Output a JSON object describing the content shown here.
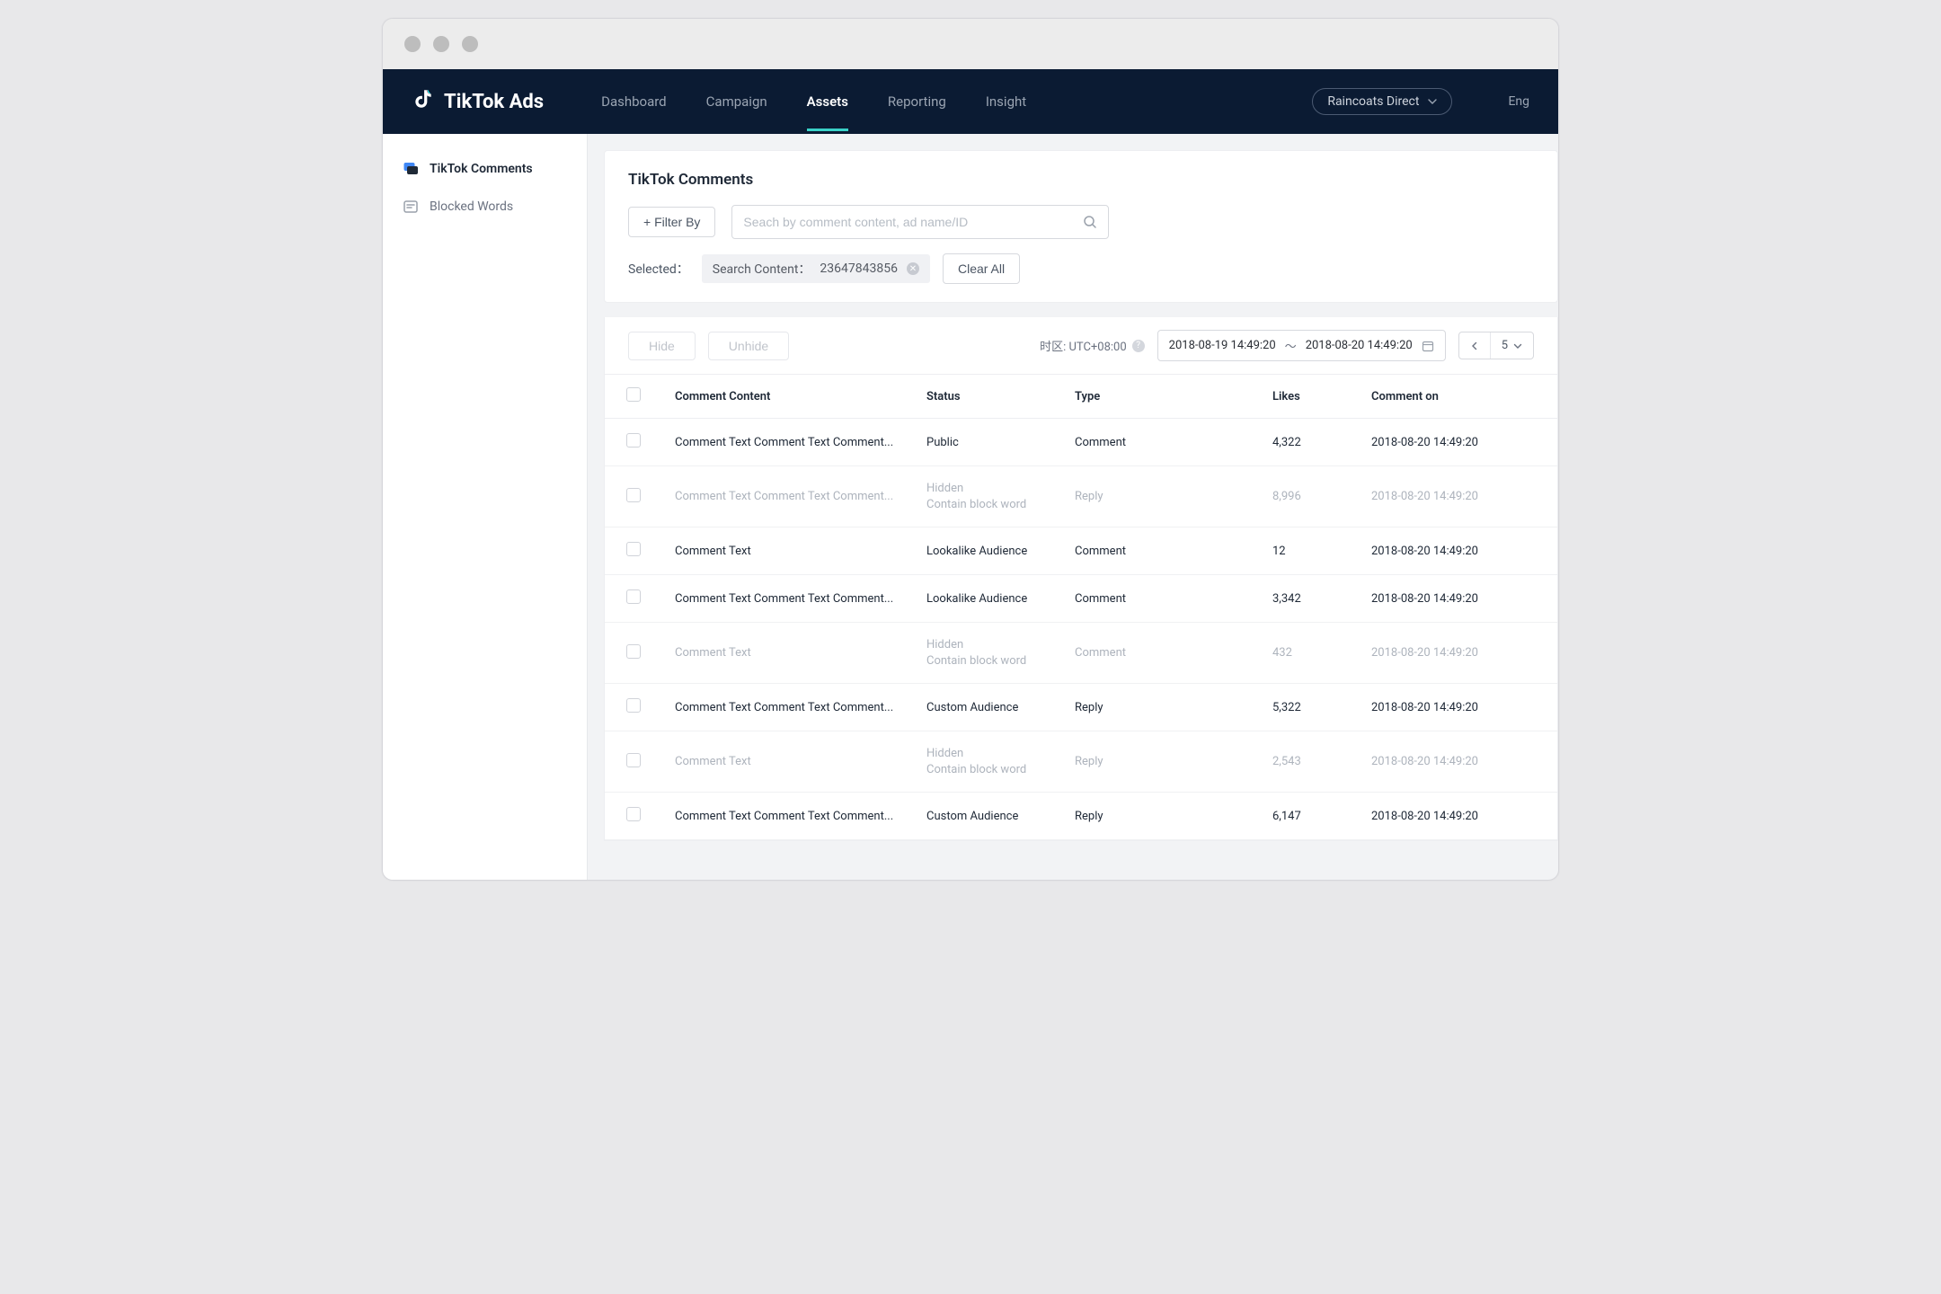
{
  "brand": {
    "name": "TikTok Ads"
  },
  "nav": {
    "items": [
      {
        "label": "Dashboard",
        "active": false
      },
      {
        "label": "Campaign",
        "active": false
      },
      {
        "label": "Assets",
        "active": true
      },
      {
        "label": "Reporting",
        "active": false
      },
      {
        "label": "Insight",
        "active": false
      }
    ],
    "account": "Raincoats Direct",
    "lang": "Eng"
  },
  "sidebar": {
    "items": [
      {
        "label": "TikTok Comments",
        "icon": "comments-icon",
        "active": true
      },
      {
        "label": "Blocked Words",
        "icon": "blocked-icon",
        "active": false
      }
    ]
  },
  "panel": {
    "title": "TikTok Comments",
    "filter_button": "+ Filter By",
    "search_placeholder": "Seach by comment content, ad name/ID",
    "selected_label": "Selected：",
    "selected_chip_prefix": "Search Content：",
    "selected_chip_value": "23647843856",
    "clear_all": "Clear All"
  },
  "toolbar": {
    "hide": "Hide",
    "unhide": "Unhide",
    "tz_label": "时区: UTC+08:00",
    "date_from": "2018-08-19 14:49:20",
    "date_sep": "～",
    "date_to": "2018-08-20 14:49:20",
    "page_size": "5"
  },
  "table": {
    "headers": {
      "content": "Comment Content",
      "status": "Status",
      "type": "Type",
      "likes": "Likes",
      "date": "Comment on"
    },
    "rows": [
      {
        "content": "Comment Text Comment Text Comment...",
        "status1": "Public",
        "status2": "",
        "type": "Comment",
        "likes": "4,322",
        "date": "2018-08-20 14:49:20",
        "dim": false
      },
      {
        "content": "Comment Text Comment Text Comment...",
        "status1": "Hidden",
        "status2": "Contain block word",
        "type": "Reply",
        "likes": "8,996",
        "date": "2018-08-20 14:49:20",
        "dim": true
      },
      {
        "content": "Comment Text",
        "status1": "Lookalike Audience",
        "status2": "",
        "type": "Comment",
        "likes": "12",
        "date": "2018-08-20 14:49:20",
        "dim": false
      },
      {
        "content": "Comment Text Comment Text Comment...",
        "status1": "Lookalike Audience",
        "status2": "",
        "type": "Comment",
        "likes": "3,342",
        "date": "2018-08-20 14:49:20",
        "dim": false
      },
      {
        "content": "Comment Text",
        "status1": "Hidden",
        "status2": "Contain block word",
        "type": "Comment",
        "likes": "432",
        "date": "2018-08-20 14:49:20",
        "dim": true
      },
      {
        "content": "Comment Text Comment Text Comment...",
        "status1": "Custom Audience",
        "status2": "",
        "type": "Reply",
        "likes": "5,322",
        "date": "2018-08-20 14:49:20",
        "dim": false
      },
      {
        "content": "Comment Text",
        "status1": "Hidden",
        "status2": "Contain block word",
        "type": "Reply",
        "likes": "2,543",
        "date": "2018-08-20 14:49:20",
        "dim": true
      },
      {
        "content": "Comment Text Comment Text Comment...",
        "status1": "Custom Audience",
        "status2": "",
        "type": "Reply",
        "likes": "6,147",
        "date": "2018-08-20 14:49:20",
        "dim": false
      }
    ]
  }
}
